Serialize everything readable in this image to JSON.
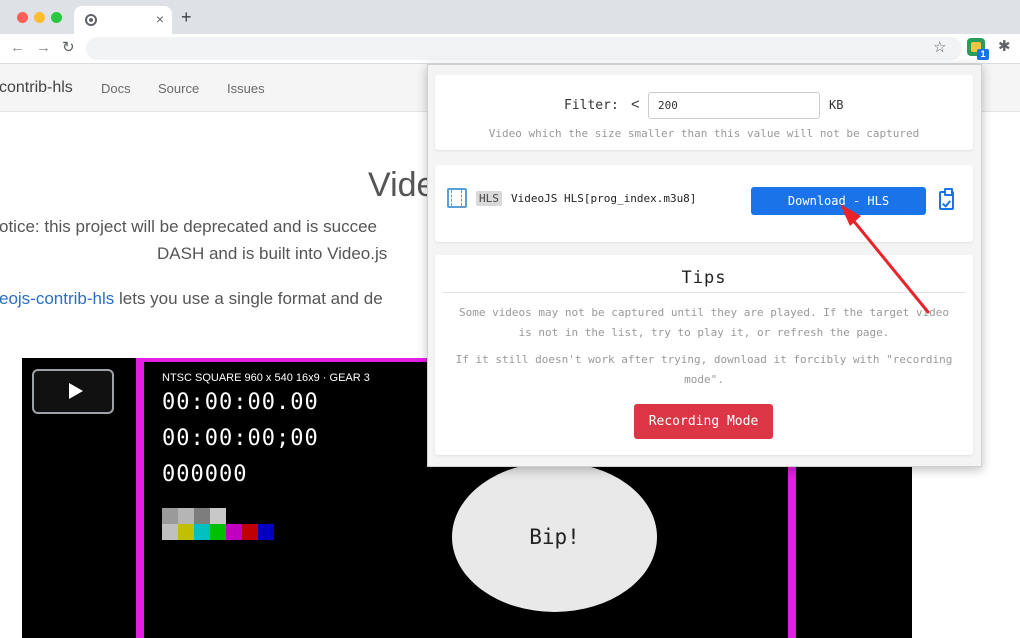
{
  "browser": {
    "tab": {
      "favicon": "chrome-logo-icon",
      "close": "×"
    },
    "new_tab": "+",
    "nav": {
      "back": "←",
      "forward": "→",
      "reload": "↻",
      "bookmark": "☆",
      "extensions": "✱"
    },
    "extension_badge": "1"
  },
  "page": {
    "brand": "contrib-hls",
    "nav_links": [
      "Docs",
      "Source",
      "Issues"
    ],
    "title": "Vide",
    "paragraphs": {
      "p1": "otice: this project will be deprecated and is succee",
      "p2": "DASH and is built into Video.js",
      "p3_link": "eojs-contrib-hls",
      "p3_rest": " lets you use a single format and de"
    }
  },
  "video": {
    "caption": "NTSC SQUARE  960 x 540  16x9  ·  GEAR 3",
    "timecode1": "00:00:00.00",
    "timecode2": "00:00:00;00",
    "timecode3": "000000",
    "bip": "Bip!"
  },
  "popup": {
    "filter": {
      "label": "Filter:",
      "lt": "<",
      "value": "200",
      "unit": "KB",
      "hint": "Video which the size smaller than this value will not be captured"
    },
    "media": {
      "icon": "film-icon",
      "type": "HLS",
      "name": "VideoJS HLS[prog_index.m3u8]",
      "download_label": "Download - HLS",
      "copy_icon": "clipboard-check-icon"
    },
    "tips": {
      "title": "Tips",
      "text1": "Some videos may not be captured until they are played. If the target video is not in the list, try to play it, or refresh the page.",
      "text2": "If it still doesn't work after trying, download it forcibly with \"recording mode\".",
      "recording_label": "Recording Mode"
    }
  },
  "colors": {
    "accent_blue": "#1a73e8",
    "record_red": "#dc3545",
    "frame_magenta": "#e21fe2",
    "annotation_red": "#e8232a"
  }
}
